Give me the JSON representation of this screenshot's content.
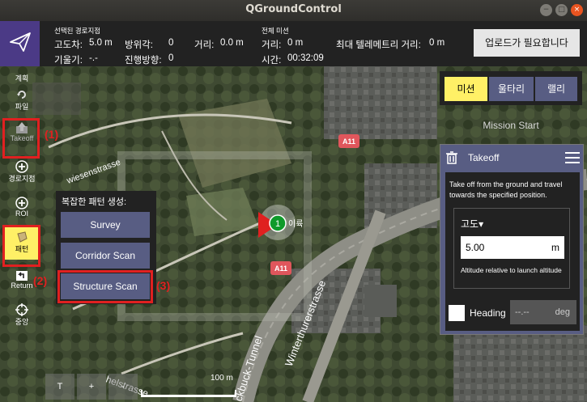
{
  "window": {
    "title": "QGroundControl"
  },
  "toolbar": {
    "selected_waypoint_label": "선택된 경로지점",
    "altitude_diff_label": "고도차:",
    "altitude_diff_value": "5.0 m",
    "gradient_label": "기울기:",
    "gradient_value": "-.-",
    "azimuth_label": "방위각:",
    "azimuth_value": "0",
    "heading_label": "진행방향:",
    "heading_value": "0",
    "distance_label": "거리:",
    "distance_value": "0.0 m",
    "total_mission_label": "전체 미션",
    "total_distance_label": "거리:",
    "total_distance_value": "0 m",
    "time_label": "시간:",
    "time_value": "00:32:09",
    "max_telemetry_label": "최대 텔레메트리 거리:",
    "max_telemetry_value": "0 m",
    "upload_button": "업로드가 필요합니다"
  },
  "left_tools": [
    {
      "label": "계획",
      "icon": "plan-icon"
    },
    {
      "label": "파일",
      "icon": "file-icon"
    },
    {
      "label": "Takeoff",
      "icon": "takeoff-icon"
    },
    {
      "label": "경로지점",
      "icon": "waypoint-icon"
    },
    {
      "label": "ROI",
      "icon": "roi-icon"
    },
    {
      "label": "패턴",
      "icon": "pattern-icon"
    },
    {
      "label": "Return",
      "icon": "return-icon"
    },
    {
      "label": "중앙",
      "icon": "center-icon"
    }
  ],
  "annotations": {
    "takeoff": "(1)",
    "pattern": "(2)",
    "structure": "(3)"
  },
  "pattern_popup": {
    "title": "복잡한 패턴 생성:",
    "options": [
      "Survey",
      "Corridor Scan",
      "Structure Scan"
    ]
  },
  "right_panel": {
    "tabs": [
      "미션",
      "울타리",
      "랠리"
    ],
    "mission_start": "Mission Start",
    "takeoff": {
      "title": "Takeoff",
      "description": "Take off from the ground and travel towards the specified position.",
      "altitude_mode": "고도",
      "altitude_value": "5.00",
      "altitude_unit": "m",
      "altitude_help": "Altitude relative to launch altitude",
      "heading_label": "Heading",
      "heading_value": "--.--",
      "heading_unit": "deg"
    }
  },
  "map": {
    "road_badge_1": "A11",
    "road_badge_2": "A11",
    "street_1": "Winterthurerstrasse",
    "street_2": "wiesenstrasse",
    "street_3": "ckbuck-Tunnel",
    "street_4": "helstrasse",
    "marker_number": "1",
    "marker_label": "이륙",
    "scale": "100 m",
    "controls": [
      "T",
      "+",
      "-"
    ]
  },
  "colors": {
    "accent": "#fff066",
    "panel": "#585d83",
    "brand": "#4b3a86",
    "annotation": "#e02020"
  }
}
